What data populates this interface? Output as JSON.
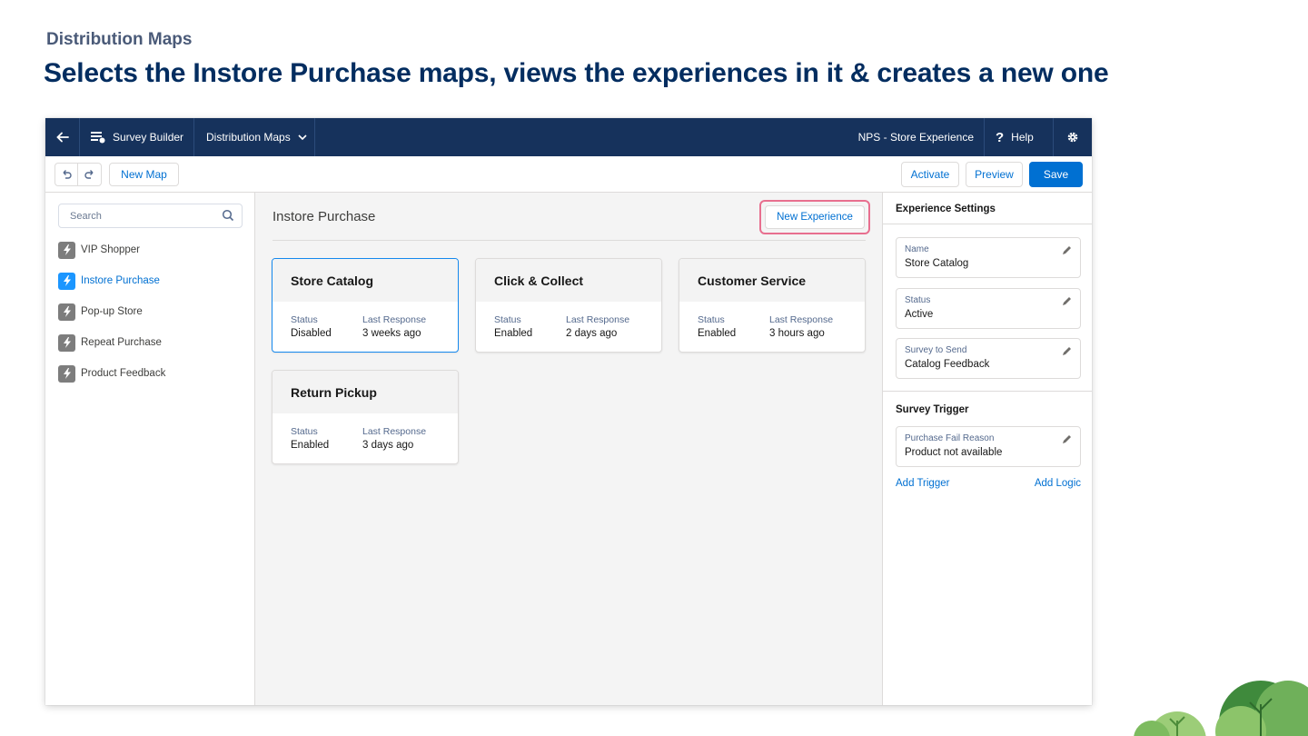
{
  "slide": {
    "kicker": "Distribution Maps",
    "title": "Selects the Instore Purchase maps, views the experiences in it & creates a new one"
  },
  "nav": {
    "back_icon": "arrow-left-icon",
    "builder_label": "Survey  Builder",
    "maps_label": "Distribution Maps",
    "survey_name": "NPS - Store Experience",
    "help_label": "Help",
    "colors": {
      "bar": "#16325c"
    }
  },
  "toolbar": {
    "new_map": "New Map",
    "activate": "Activate",
    "preview": "Preview",
    "save": "Save"
  },
  "sidebar": {
    "search_placeholder": "Search",
    "items": [
      {
        "label": "VIP Shopper",
        "active": false
      },
      {
        "label": "Instore Purchase",
        "active": true
      },
      {
        "label": "Pop-up Store",
        "active": false
      },
      {
        "label": "Repeat Purchase",
        "active": false
      },
      {
        "label": "Product Feedback",
        "active": false
      }
    ]
  },
  "main": {
    "title": "Instore Purchase",
    "new_experience": "New Experience",
    "status_label": "Status",
    "last_response_label": "Last Response",
    "cards": [
      {
        "title": "Store Catalog",
        "status": "Disabled",
        "last_response": "3 weeks ago",
        "selected": true
      },
      {
        "title": "Click & Collect",
        "status": "Enabled",
        "last_response": "2 days ago",
        "selected": false
      },
      {
        "title": "Customer Service",
        "status": "Enabled",
        "last_response": "3 hours ago",
        "selected": false
      },
      {
        "title": "Return Pickup",
        "status": "Enabled",
        "last_response": "3 days ago",
        "selected": false
      }
    ]
  },
  "panel": {
    "settings_title": "Experience Settings",
    "fields": [
      {
        "label": "Name",
        "value": "Store Catalog"
      },
      {
        "label": "Status",
        "value": "Active"
      },
      {
        "label": "Survey to Send",
        "value": "Catalog Feedback"
      }
    ],
    "trigger_title": "Survey Trigger",
    "trigger_field": {
      "label": "Purchase Fail Reason",
      "value": "Product not available"
    },
    "add_trigger": "Add Trigger",
    "add_logic": "Add Logic"
  }
}
